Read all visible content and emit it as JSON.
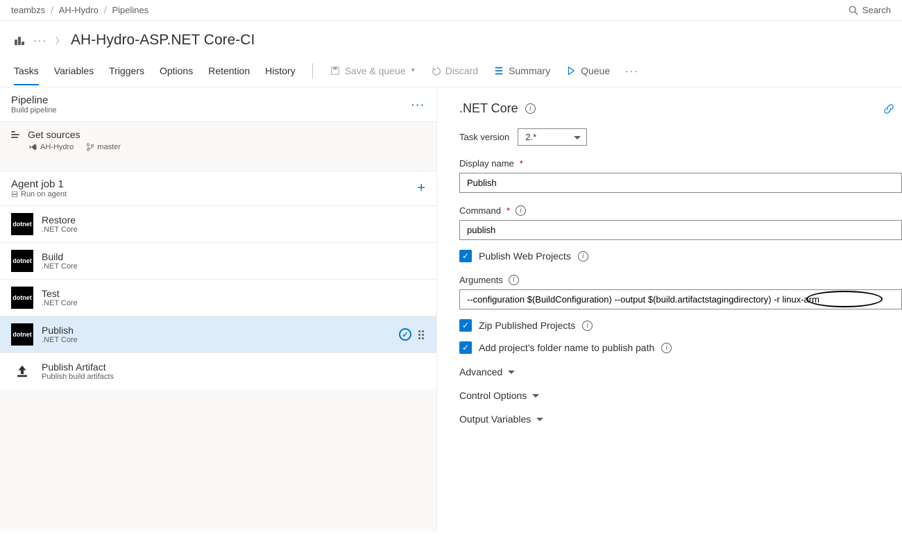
{
  "breadcrumb": {
    "org": "teambzs",
    "project": "AH-Hydro",
    "area": "Pipelines"
  },
  "search_label": "Search",
  "title": "AH-Hydro-ASP.NET Core-CI",
  "tabs": [
    "Tasks",
    "Variables",
    "Triggers",
    "Options",
    "Retention",
    "History"
  ],
  "commands": {
    "save_queue": "Save & queue",
    "discard": "Discard",
    "summary": "Summary",
    "queue": "Queue"
  },
  "pipeline": {
    "heading": "Pipeline",
    "sub": "Build pipeline",
    "get_sources": "Get sources",
    "repo": "AH-Hydro",
    "branch": "master"
  },
  "agent": {
    "name": "Agent job 1",
    "sub": "Run on agent"
  },
  "tasks": [
    {
      "name": "Restore",
      "sub": ".NET Core",
      "type": "dotnet"
    },
    {
      "name": "Build",
      "sub": ".NET Core",
      "type": "dotnet"
    },
    {
      "name": "Test",
      "sub": ".NET Core",
      "type": "dotnet"
    },
    {
      "name": "Publish",
      "sub": ".NET Core",
      "type": "dotnet",
      "selected": true
    },
    {
      "name": "Publish Artifact",
      "sub": "Publish build artifacts",
      "type": "artifact"
    }
  ],
  "detail": {
    "title": ".NET Core",
    "task_version_label": "Task version",
    "task_version": "2.*",
    "display_name_label": "Display name",
    "display_name": "Publish",
    "command_label": "Command",
    "command": "publish",
    "publish_web_label": "Publish Web Projects",
    "arguments_label": "Arguments",
    "arguments": "--configuration $(BuildConfiguration) --output $(build.artifactstagingdirectory) -r linux-arm",
    "zip_label": "Zip Published Projects",
    "add_folder_label": "Add project's folder name to publish path",
    "sections": [
      "Advanced",
      "Control Options",
      "Output Variables"
    ]
  }
}
